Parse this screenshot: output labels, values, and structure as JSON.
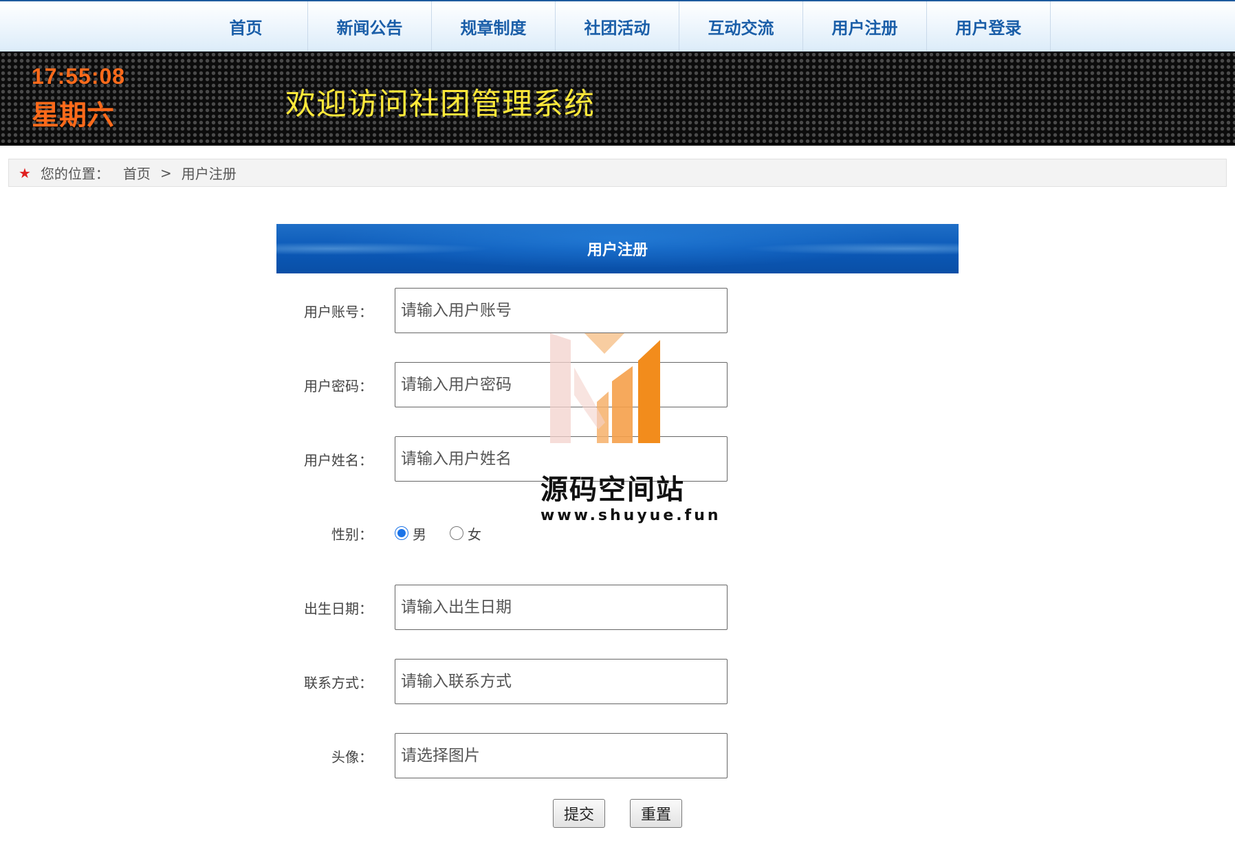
{
  "nav": {
    "items": [
      "首页",
      "新闻公告",
      "规章制度",
      "社团活动",
      "互动交流",
      "用户注册",
      "用户登录"
    ]
  },
  "banner": {
    "time": "17:55:08",
    "weekday": "星期六",
    "title": "欢迎访问社团管理系统"
  },
  "breadcrumb": {
    "prefix": "您的位置：",
    "home": "首页",
    "separator": ">",
    "current": "用户注册"
  },
  "form": {
    "title": "用户注册",
    "account": {
      "label": "用户账号：",
      "placeholder": "请输入用户账号",
      "value": ""
    },
    "password": {
      "label": "用户密码：",
      "placeholder": "请输入用户密码",
      "value": ""
    },
    "name": {
      "label": "用户姓名：",
      "placeholder": "请输入用户姓名",
      "value": ""
    },
    "gender": {
      "label": "性别：",
      "options": [
        "男",
        "女"
      ],
      "selected": "男"
    },
    "birthday": {
      "label": "出生日期：",
      "placeholder": "请输入出生日期",
      "value": ""
    },
    "contact": {
      "label": "联系方式：",
      "placeholder": "请输入联系方式",
      "value": ""
    },
    "avatar": {
      "label": "头像：",
      "placeholder": "请选择图片",
      "value": ""
    },
    "submit_label": "提交",
    "reset_label": "重置"
  },
  "watermark": {
    "text": "源码空间站",
    "url": "www.shuyue.fun"
  },
  "colors": {
    "nav_text": "#1a5ea8",
    "clock": "#ff6a1a",
    "banner_title": "#ffe93a",
    "panel_header": "#0b59b8"
  }
}
